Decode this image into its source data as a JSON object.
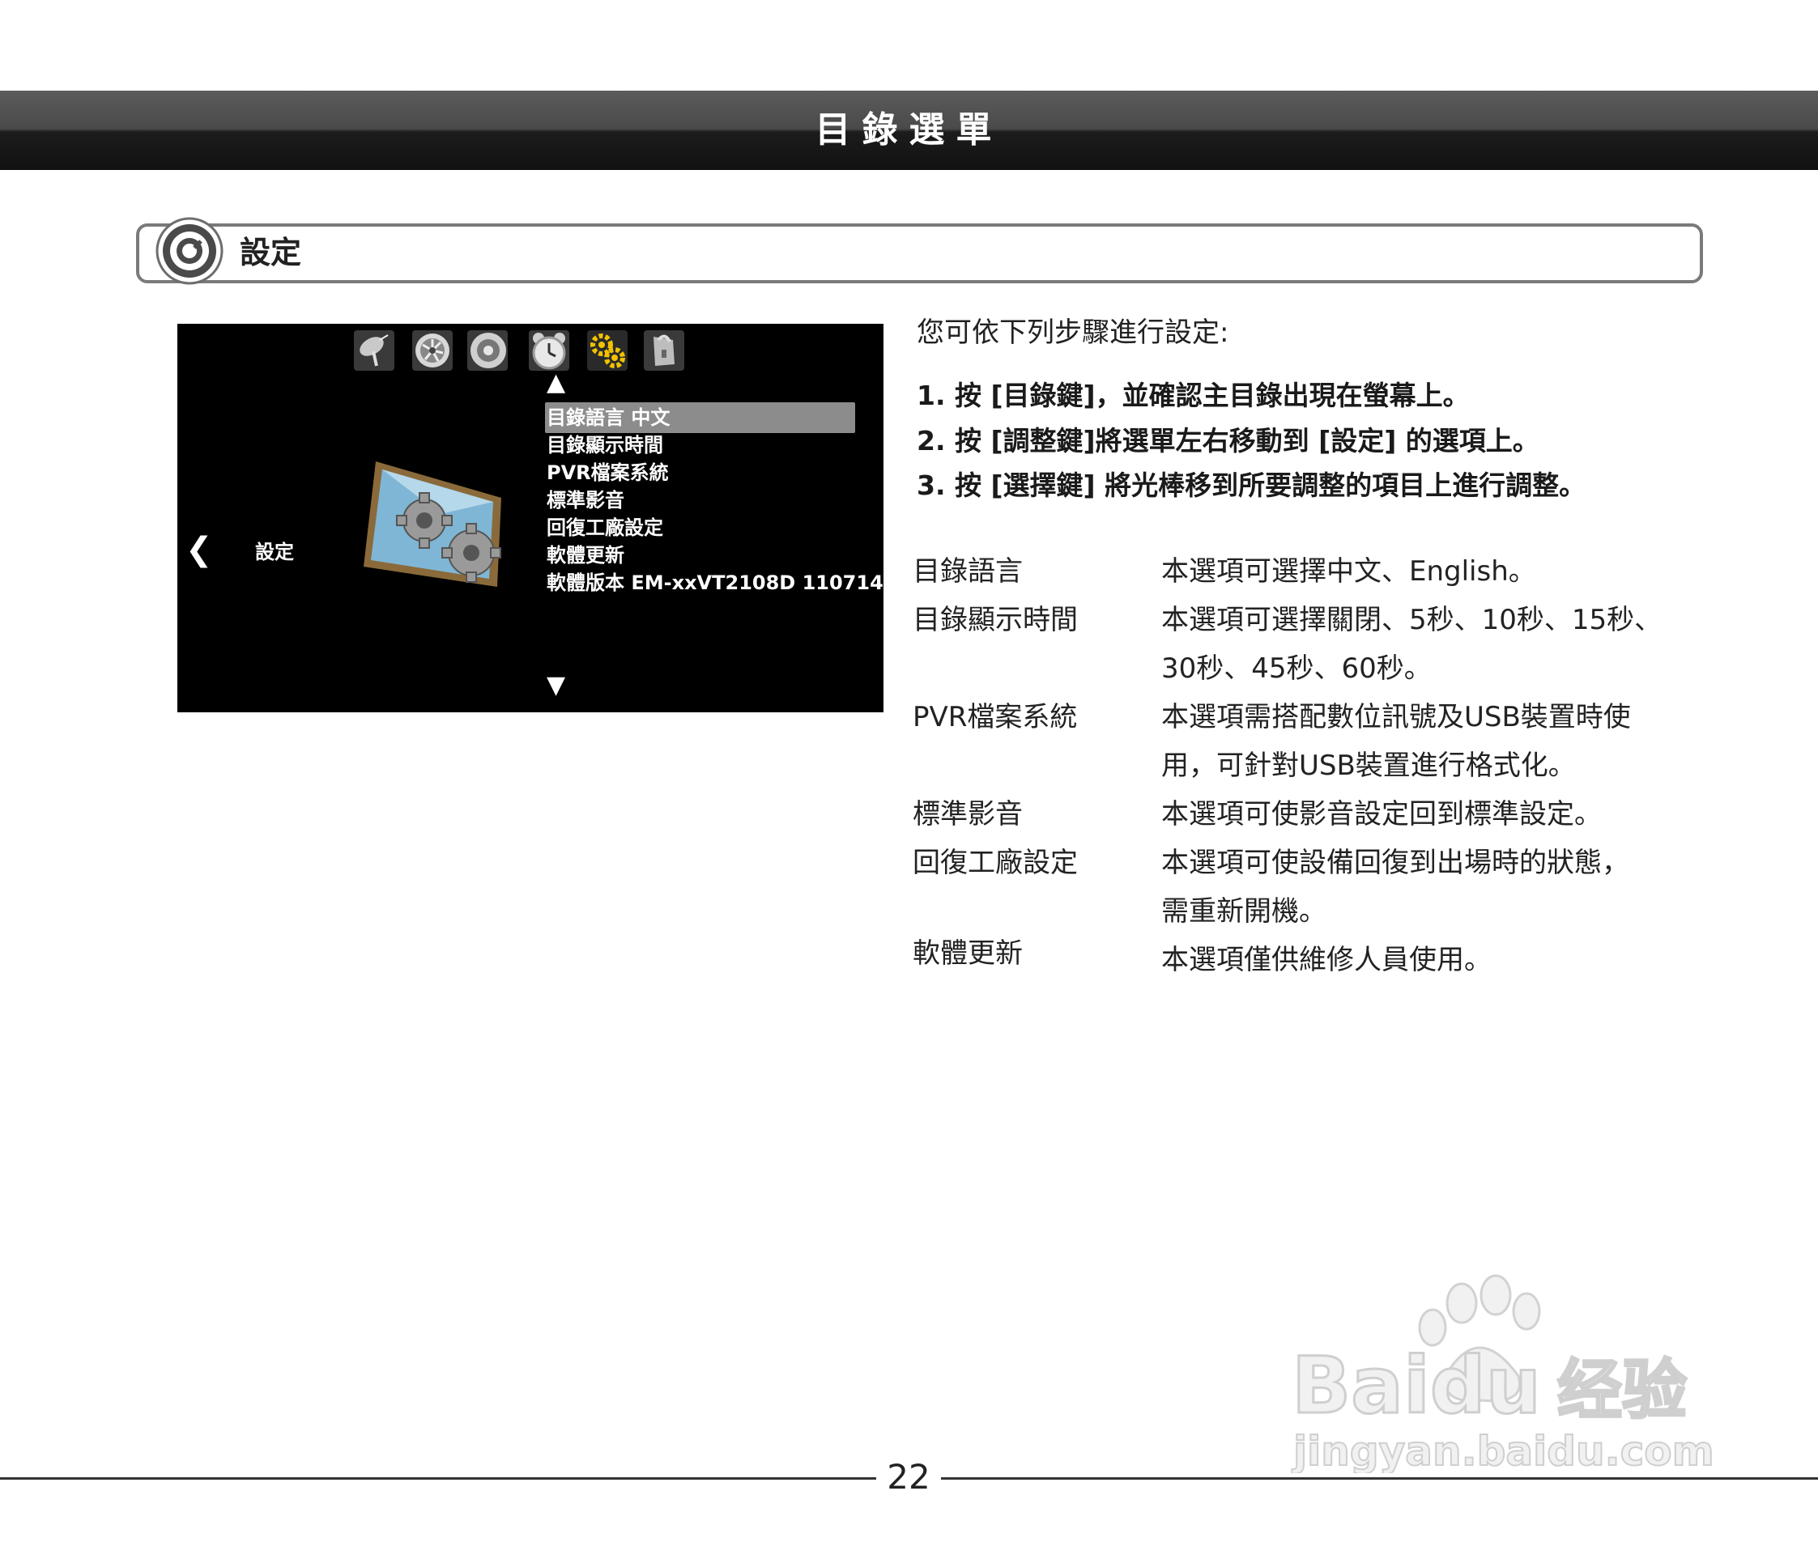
{
  "header": {
    "title": "目錄選單"
  },
  "section": {
    "title": "設定",
    "icon": "target-icon"
  },
  "tv_screen": {
    "tab_icons": [
      "satellite-icon",
      "fan-icon",
      "speaker-icon",
      "alarm-clock-icon",
      "gears-icon",
      "lock-icon"
    ],
    "up_arrow": "▲",
    "down_arrow": "▼",
    "back_arrow": "❮",
    "category_label": "設定",
    "menu_items": [
      "目錄語言 中文",
      "目錄顯示時間",
      "PVR檔案系統",
      "標準影音",
      "回復工廠設定",
      "軟體更新",
      "軟體版本 EM-xxVT2108D 110714"
    ],
    "selected_index": 0
  },
  "instructions": {
    "intro": "您可依下列步驟進行設定:",
    "steps": [
      "1. 按 [目錄鍵]，並確認主目錄出現在螢幕上。",
      "2. 按 [調整鍵]將選單左右移動到 [設定] 的選項上。",
      "3. 按 [選擇鍵] 將光棒移到所要調整的項目上進行調整。"
    ]
  },
  "options": [
    {
      "label": "目錄語言",
      "desc": [
        "本選項可選擇中文、English。"
      ]
    },
    {
      "label": "目錄顯示時間",
      "desc": [
        "本選項可選擇關閉、5秒、10秒、15秒、",
        "30秒、45秒、60秒。"
      ]
    },
    {
      "label": "PVR檔案系統",
      "desc": [
        "本選項需搭配數位訊號及USB裝置時使",
        "用，可針對USB裝置進行格式化。"
      ]
    },
    {
      "label": "標準影音",
      "desc": [
        "本選項可使影音設定回到標準設定。"
      ]
    },
    {
      "label": "回復工廠設定",
      "desc": [
        "本選項可使設備回復到出場時的狀態，",
        "需重新開機。"
      ]
    },
    {
      "label": "軟體更新",
      "desc": [
        "本選項僅供維修人員使用。"
      ]
    }
  ],
  "watermark": {
    "brand": "Baidu",
    "brand_cn": "经验",
    "url": "jingyan.baidu.com"
  },
  "footer": {
    "page_number": "22"
  }
}
